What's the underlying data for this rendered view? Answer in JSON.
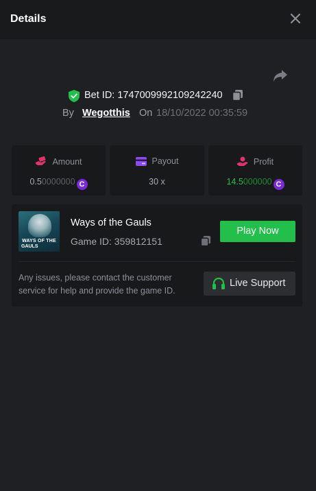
{
  "header": {
    "title": "Details"
  },
  "bet": {
    "id_label": "Bet ID: 1747009992109242240",
    "by_label": "By",
    "username": "Wegotthis",
    "on_label": "On",
    "datetime": "18/10/2022 00:35:59"
  },
  "stats": [
    {
      "label": "Amount",
      "value_main": "0.5",
      "value_dim": "0000000",
      "icon": "money-hand-icon",
      "icon_color": "#e0336b"
    },
    {
      "label": "Payout",
      "value_main": "30 x",
      "value_dim": "",
      "icon": "card-icon",
      "icon_color": "#8a4bf0"
    },
    {
      "label": "Profit",
      "value_main": "14.5",
      "value_dim": "000000",
      "icon": "profit-hand-icon",
      "icon_color": "#e0336b"
    }
  ],
  "coin_glyph": "C",
  "game": {
    "thumb_line1": "WAYS OF THE",
    "thumb_line2": "GAULS",
    "name": "Ways of the Gauls",
    "id_label": "Game ID: 359812151",
    "play_label": "Play Now"
  },
  "support": {
    "notice": "Any issues, please contact the customer service for help and provide the game ID.",
    "button_label": "Live Support"
  },
  "colors": {
    "accent_green": "#22c04a",
    "coin_purple": "#7b2ad8",
    "profit_green": "#22c04a"
  }
}
